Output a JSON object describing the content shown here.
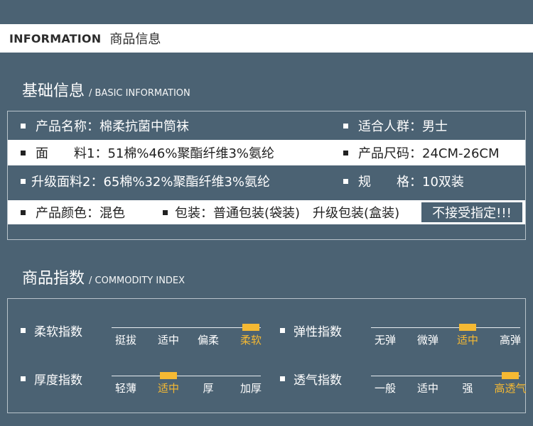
{
  "header": {
    "en": "INFORMATION",
    "cn": "商品信息"
  },
  "basic": {
    "title_cn": "基础信息",
    "title_en": "/ BASIC INFORMATION",
    "rows": [
      {
        "left": "产品名称：棉柔抗菌中筒袜",
        "right": "适合人群：男士"
      },
      {
        "left": "面　　料1：51棉%46%聚酯纤维3%氨纶",
        "right": "产品尺码：24CM-26CM"
      },
      {
        "left": "升级面料2：65棉%32%聚酯纤维3%氨纶",
        "right": "规　　格：10双装"
      },
      {
        "left": "产品颜色：混色",
        "middle": "包装：普通包装(袋装)　升级包装(盒装)",
        "badge": "不接受指定!!!"
      }
    ]
  },
  "commodity": {
    "title_cn": "商品指数",
    "title_en": "/ COMMODITY INDEX",
    "indices": [
      {
        "name": "柔软指数",
        "levels": [
          "挺拔",
          "适中",
          "偏柔",
          "柔软"
        ],
        "selected": 3
      },
      {
        "name": "弹性指数",
        "levels": [
          "无弹",
          "微弹",
          "适中",
          "高弹"
        ],
        "selected": 2
      },
      {
        "name": "厚度指数",
        "levels": [
          "轻薄",
          "适中",
          "厚",
          "加厚"
        ],
        "selected": 1
      },
      {
        "name": "透气指数",
        "levels": [
          "一般",
          "适中",
          "强",
          "高透气"
        ],
        "selected": 3
      }
    ],
    "colors": {
      "accent": "#f5b933",
      "background": "#4b6273"
    }
  }
}
